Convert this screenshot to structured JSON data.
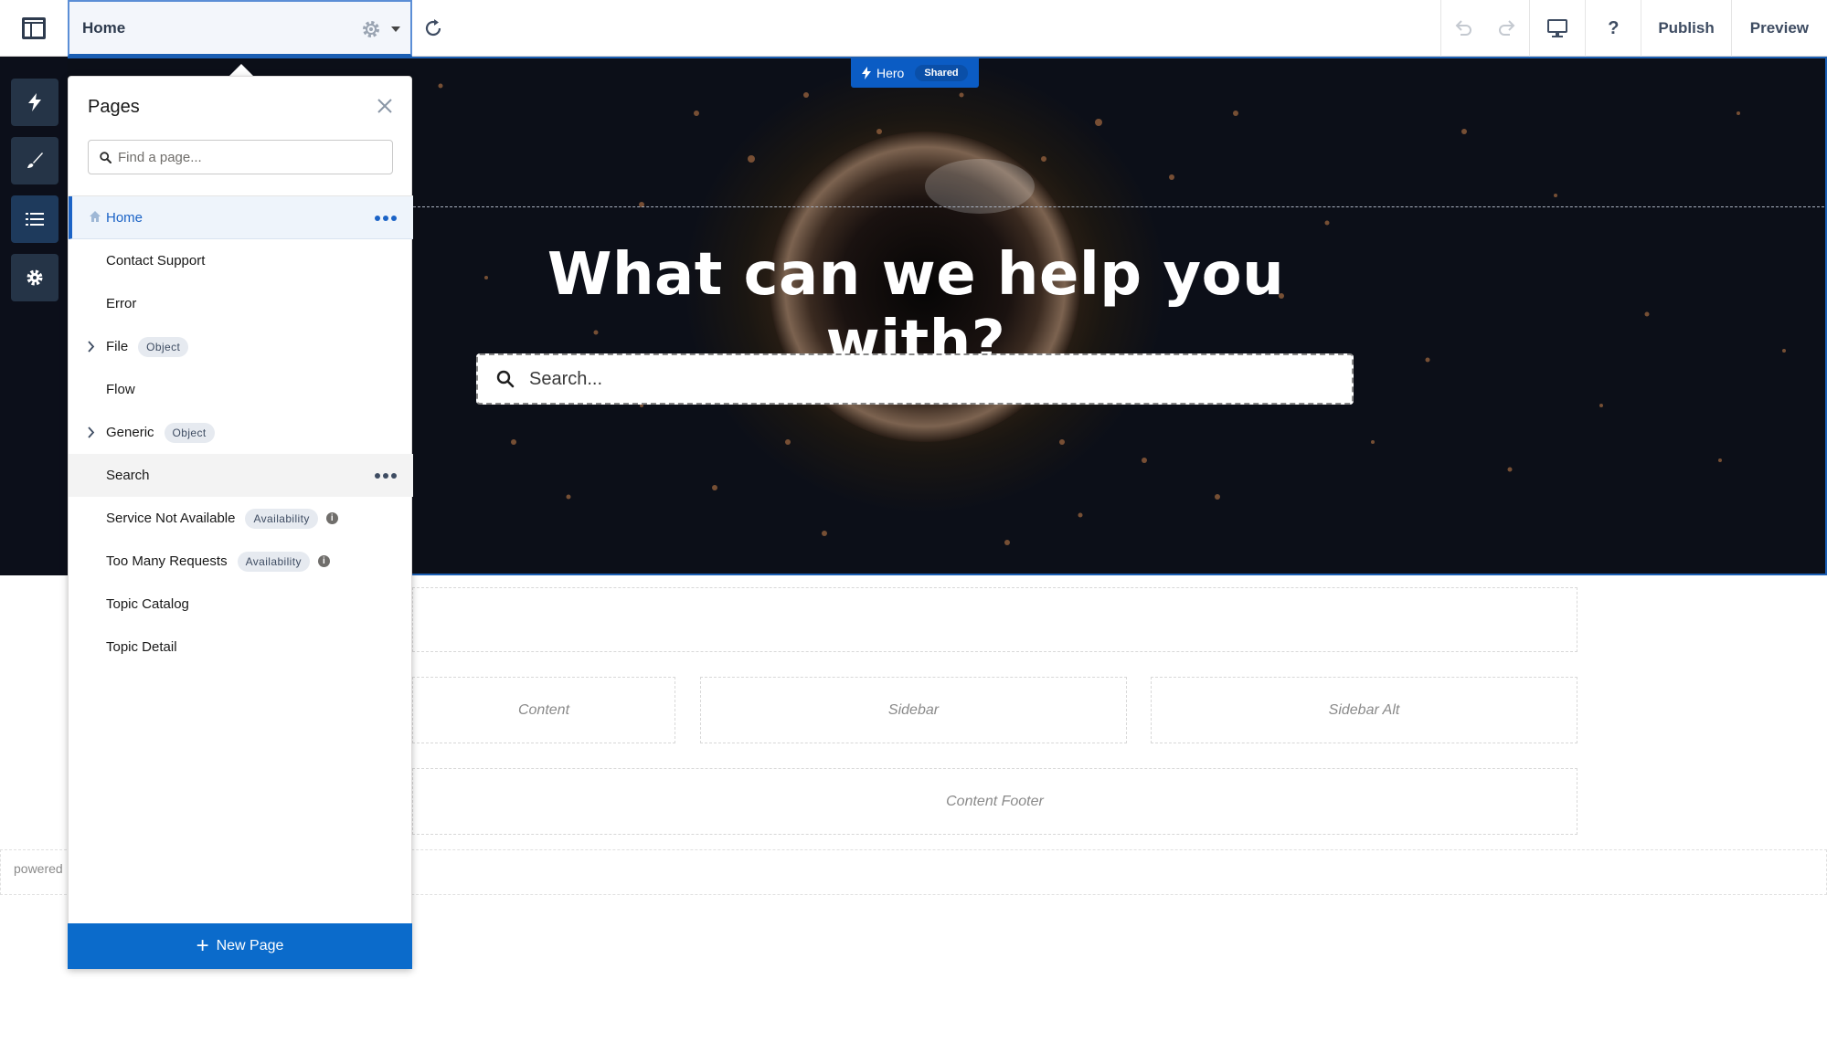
{
  "topbar": {
    "current_page": "Home",
    "publish_label": "Publish",
    "preview_label": "Preview",
    "help_label": "?"
  },
  "hero": {
    "component_label": "Hero",
    "component_badge": "Shared",
    "headline": "What can we help you with?",
    "search_placeholder": "Search..."
  },
  "layout": {
    "content_label": "Content",
    "sidebar_label": "Sidebar",
    "sidebar_alt_label": "Sidebar Alt",
    "content_footer_label": "Content Footer",
    "powered_text": "powered"
  },
  "pages_panel": {
    "title": "Pages",
    "search_placeholder": "Find a page...",
    "new_page_label": "New Page",
    "items": [
      {
        "label": "Home",
        "badge": "",
        "info": false,
        "expandable": false
      },
      {
        "label": "Contact Support",
        "badge": "",
        "info": false,
        "expandable": false
      },
      {
        "label": "Error",
        "badge": "",
        "info": false,
        "expandable": false
      },
      {
        "label": "File",
        "badge": "Object",
        "info": false,
        "expandable": true
      },
      {
        "label": "Flow",
        "badge": "",
        "info": false,
        "expandable": false
      },
      {
        "label": "Generic",
        "badge": "Object",
        "info": false,
        "expandable": true
      },
      {
        "label": "Search",
        "badge": "",
        "info": false,
        "expandable": false
      },
      {
        "label": "Service Not Available",
        "badge": "Availability",
        "info": true,
        "expandable": false
      },
      {
        "label": "Too Many Requests",
        "badge": "Availability",
        "info": true,
        "expandable": false
      },
      {
        "label": "Topic Catalog",
        "badge": "",
        "info": false,
        "expandable": false
      },
      {
        "label": "Topic Detail",
        "badge": "",
        "info": false,
        "expandable": false
      }
    ]
  },
  "colors": {
    "brand_blue": "#0b6bcb",
    "hero_label_blue": "#0b5cc4",
    "hero_bg": "#0c0f1a"
  }
}
